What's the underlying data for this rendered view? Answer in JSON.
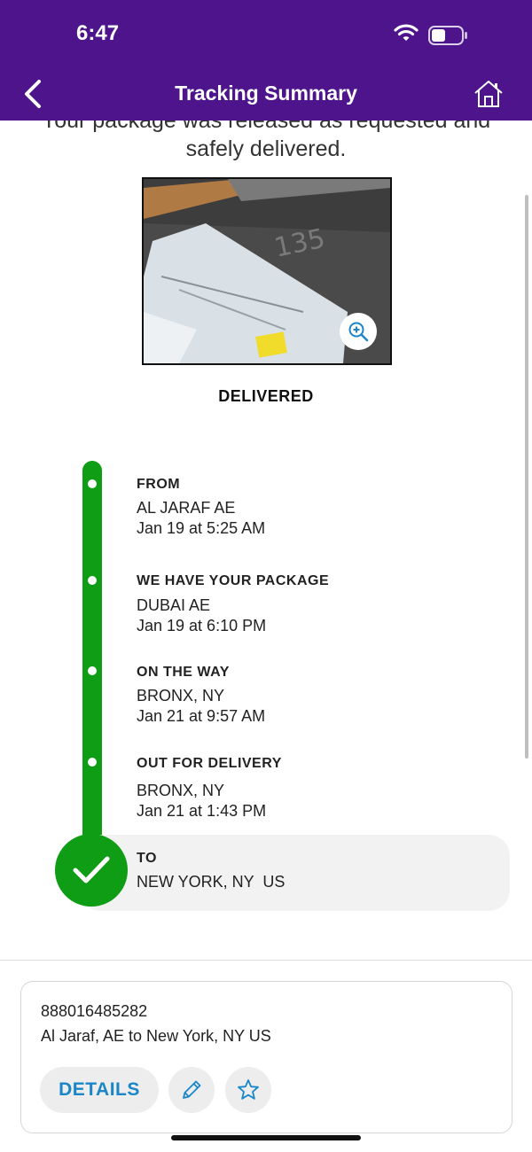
{
  "status_bar": {
    "time": "6:47"
  },
  "header": {
    "title": "Tracking Summary"
  },
  "message": {
    "line1": "Your package was released as requested and",
    "line2": "safely delivered."
  },
  "status_label": "DELIVERED",
  "timeline": [
    {
      "title": "FROM",
      "location": "AL JARAF AE",
      "time": "Jan 19 at 5:25 AM"
    },
    {
      "title": "WE HAVE YOUR PACKAGE",
      "location": "DUBAI AE",
      "time": "Jan 19 at 6:10 PM"
    },
    {
      "title": "ON THE WAY",
      "location": "BRONX, NY",
      "time": "Jan 21 at 9:57 AM"
    },
    {
      "title": "OUT FOR DELIVERY",
      "location": "BRONX, NY",
      "time": "Jan 21 at 1:43 PM"
    },
    {
      "title": "TO",
      "location": "NEW YORK, NY  US"
    }
  ],
  "card": {
    "tracking_number": "888016485282",
    "route": "Al Jaraf, AE to New York, NY US",
    "details_label": "DETAILS"
  },
  "colors": {
    "header": "#4d148c",
    "timeline": "#0f9d15",
    "link": "#1a86c8"
  },
  "icons": [
    "back-chevron-icon",
    "home-icon",
    "wifi-icon",
    "battery-icon",
    "zoom-in-icon",
    "checkmark-icon",
    "pencil-icon",
    "star-icon"
  ]
}
